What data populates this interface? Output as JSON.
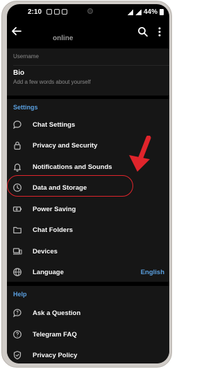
{
  "status_bar": {
    "time": "2:10",
    "battery": "44%"
  },
  "header": {
    "subtitle": "online"
  },
  "profile": {
    "username_label": "Username",
    "bio_title": "Bio",
    "bio_hint": "Add a few words about yourself"
  },
  "settings": {
    "title": "Settings",
    "items": [
      {
        "label": "Chat Settings",
        "icon": "chat-bubble-icon"
      },
      {
        "label": "Privacy and Security",
        "icon": "lock-icon"
      },
      {
        "label": "Notifications and Sounds",
        "icon": "bell-icon"
      },
      {
        "label": "Data and Storage",
        "icon": "clock-icon"
      },
      {
        "label": "Power Saving",
        "icon": "battery-icon"
      },
      {
        "label": "Chat Folders",
        "icon": "folder-icon"
      },
      {
        "label": "Devices",
        "icon": "devices-icon"
      },
      {
        "label": "Language",
        "icon": "globe-icon",
        "value": "English"
      }
    ]
  },
  "help": {
    "title": "Help",
    "items": [
      {
        "label": "Ask a Question",
        "icon": "chat-question-icon"
      },
      {
        "label": "Telegram FAQ",
        "icon": "help-circle-icon"
      },
      {
        "label": "Privacy Policy",
        "icon": "shield-check-icon"
      }
    ]
  },
  "annotation": {
    "highlight_color": "#e0242b"
  },
  "colors": {
    "accent": "#5aa0e0",
    "background": "#000000",
    "card": "#161616"
  }
}
